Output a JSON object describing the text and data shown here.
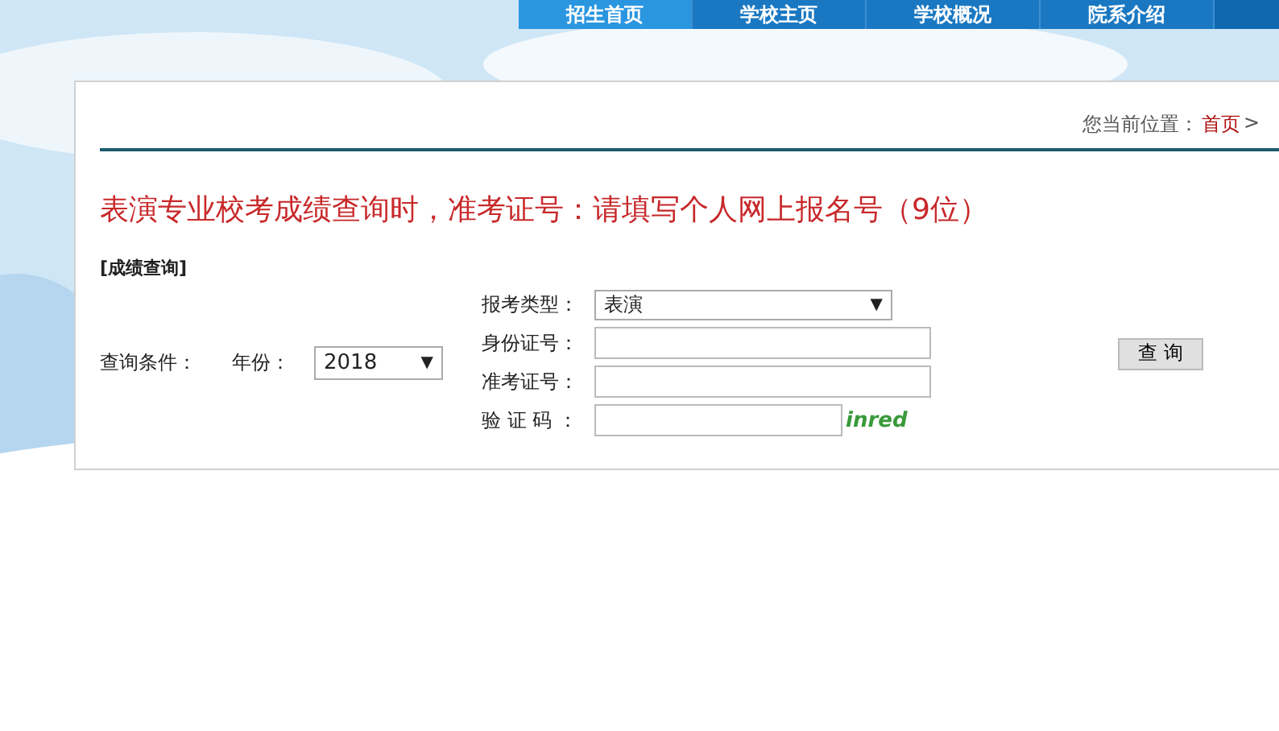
{
  "nav": {
    "tabs": [
      {
        "label": "招生首页",
        "selected": true
      },
      {
        "label": "学校主页",
        "selected": false
      },
      {
        "label": "学校概况",
        "selected": false
      },
      {
        "label": "院系介绍",
        "selected": false
      }
    ]
  },
  "breadcrumb": {
    "prefix": "您当前位置：",
    "link": "首页",
    "separator": ">"
  },
  "notice": "表演专业校考成绩查询时，准考证号：请填写个人网上报名号（9位）",
  "section_title": "[成绩查询]",
  "form": {
    "criteria_label": "查询条件：",
    "year_label": "年份：",
    "year_value": "2018",
    "arrow": "▼",
    "type_label": "报考类型：",
    "type_value": "表演",
    "id_label": "身份证号：",
    "ticket_label": "准考证号：",
    "captcha_label": "验 证 码 ：",
    "captcha_text": "inred",
    "submit": "查 询"
  }
}
